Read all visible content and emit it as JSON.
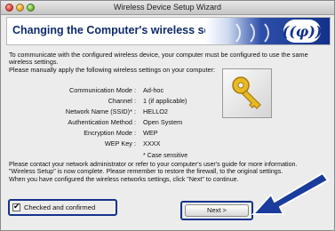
{
  "window": {
    "title": "Wireless Device Setup Wizard"
  },
  "banner": {
    "title": "Changing the Computer's wireless settings.",
    "logo_text": "((φ))"
  },
  "intro": {
    "line1": "To communicate with the configured wireless device, your computer must be configured to use the same wireless settings.",
    "line2": "Please manually apply the following wireless settings on your computer:"
  },
  "settings": [
    {
      "label": "Communication Mode :",
      "value": "Ad-hoc"
    },
    {
      "label": "Channel :",
      "value": "1   (if applicable)"
    },
    {
      "label": "Network Name (SSID)* :",
      "value": "HELLO2"
    },
    {
      "label": "Authentication Method :",
      "value": "Open System"
    },
    {
      "label": "Encryption Mode :",
      "value": "WEP"
    },
    {
      "label": "WEP Key :",
      "value": "XXXX"
    }
  ],
  "case_note": "* Case sensitive",
  "outro": {
    "line1": "Please contact your network administrator or refer to your computer's user's guide for more information.",
    "line2": "\"Wireless Setup\" is now complete. Please remember to restore the firewall, to the original settings.",
    "line3": "When you have configured the wireless networks settings, click \"Next\" to continue."
  },
  "checkbox": {
    "label": "Checked and confirmed",
    "checked": true
  },
  "buttons": {
    "next_label": "Next >"
  },
  "colors": {
    "banner_title": "#0e2a6b",
    "callout": "#16328c",
    "arrow": "#1a3c9c"
  },
  "icons": {
    "key": "key-icon",
    "arrow": "pointer-arrow-icon"
  }
}
